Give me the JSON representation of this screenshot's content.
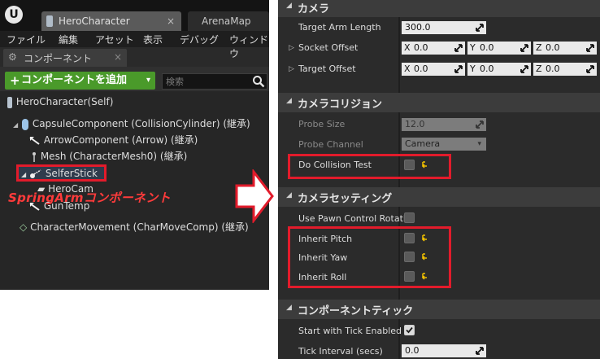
{
  "editor": {
    "logo": "U",
    "tabs": [
      {
        "label": "HeroCharacter",
        "close": "×"
      },
      {
        "label": "ArenaMap"
      }
    ],
    "menu": [
      "ファイル",
      "編集",
      "アセット",
      "表示",
      "デバッグ",
      "ウィンドウ"
    ]
  },
  "components_panel": {
    "tab_label": "コンポーネント",
    "tab_close": "×",
    "add_button": {
      "plus": "+",
      "label": "コンポーネントを追加",
      "caret": "▾"
    },
    "search_placeholder": "検索",
    "tree": {
      "root": "HeroCharacter(Self)",
      "capsule": "CapsuleComponent (CollisionCylinder) (継承)",
      "arrow": "ArrowComponent (Arrow) (継承)",
      "mesh": "Mesh (CharacterMesh0) (継承)",
      "selferstick": "SelferStick",
      "herocam": "HeroCam",
      "guntemp": "GunTemp",
      "movement": "CharacterMovement (CharMoveComp) (継承)"
    },
    "annotation": "SpringArmコンポーネント",
    "accent_color": "#e21b2b",
    "add_color": "#4a9a2a"
  },
  "details_panel": {
    "camera": {
      "header": "カメラ",
      "target_arm_length": {
        "label": "Target Arm Length",
        "value": "300.0"
      },
      "socket_offset": {
        "label": "Socket Offset",
        "x": "0.0",
        "y": "0.0",
        "z": "0.0"
      },
      "target_offset": {
        "label": "Target Offset",
        "x": "0.0",
        "y": "0.0",
        "z": "0.0"
      },
      "axis_x": "X",
      "axis_y": "Y",
      "axis_z": "Z"
    },
    "camera_collision": {
      "header": "カメラコリジョン",
      "probe_size": {
        "label": "Probe Size",
        "value": "12.0"
      },
      "probe_channel": {
        "label": "Probe Channel",
        "value": "Camera",
        "caret": "▾"
      },
      "do_collision_test": {
        "label": "Do Collision Test",
        "checked": false
      }
    },
    "camera_settings": {
      "header": "カメラセッティング",
      "use_pawn_control_rotation": {
        "label": "Use Pawn Control Rotatio",
        "checked": false
      },
      "inherit_pitch": {
        "label": "Inherit Pitch",
        "checked": false
      },
      "inherit_yaw": {
        "label": "Inherit Yaw",
        "checked": false
      },
      "inherit_roll": {
        "label": "Inherit Roll",
        "checked": false
      }
    },
    "component_tick": {
      "header": "コンポーネントティック",
      "start_with_tick_enabled": {
        "label": "Start with Tick Enabled",
        "checked": true
      },
      "tick_interval": {
        "label": "Tick Interval (secs)",
        "value": "0.0"
      }
    }
  }
}
